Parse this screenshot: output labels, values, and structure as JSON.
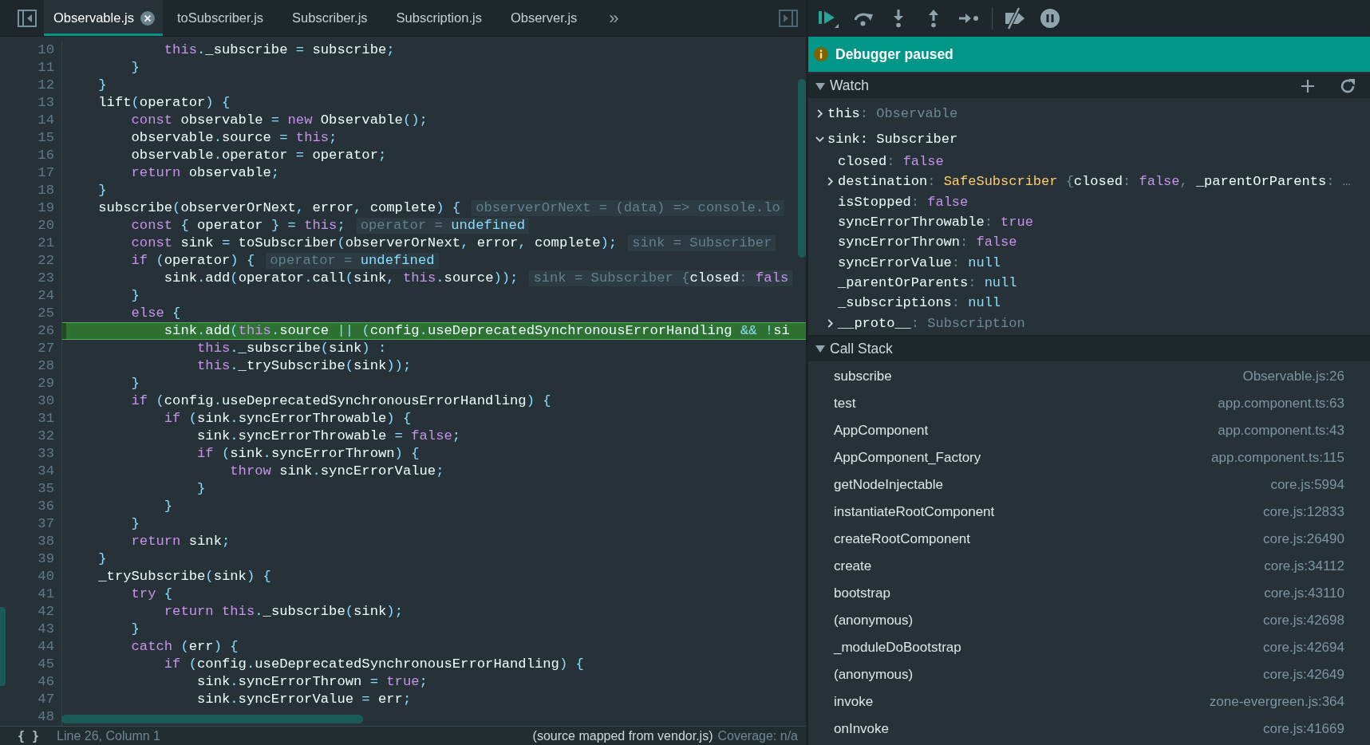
{
  "editor": {
    "tabs": [
      {
        "label": "Observable.js",
        "selected": true
      },
      {
        "label": "toSubscriber.js",
        "selected": false
      },
      {
        "label": "Subscriber.js",
        "selected": false
      },
      {
        "label": "Subscription.js",
        "selected": false
      },
      {
        "label": "Observer.js",
        "selected": false
      }
    ],
    "more_tabs": "»",
    "lines": [
      {
        "number": "10",
        "current": false,
        "tokens": [
          {
            "text": "            this",
            "kind": "keyword"
          },
          {
            "text": ".",
            "kind": "punct"
          },
          {
            "text": "_subscribe ",
            "kind": "plain"
          },
          {
            "text": "=",
            "kind": "punct"
          },
          {
            "text": " subscribe",
            "kind": "plain"
          },
          {
            "text": ";",
            "kind": "punct"
          }
        ]
      },
      {
        "number": "11",
        "current": false,
        "tokens": [
          {
            "text": "        }",
            "kind": "punct"
          }
        ]
      },
      {
        "number": "12",
        "current": false,
        "tokens": [
          {
            "text": "    }",
            "kind": "punct"
          }
        ]
      },
      {
        "number": "13",
        "current": false,
        "tokens": [
          {
            "text": "    lift",
            "kind": "plain"
          },
          {
            "text": "(",
            "kind": "punct"
          },
          {
            "text": "operator",
            "kind": "plain"
          },
          {
            "text": ") {",
            "kind": "punct"
          }
        ]
      },
      {
        "number": "14",
        "current": false,
        "tokens": [
          {
            "text": "        const",
            "kind": "keyword"
          },
          {
            "text": " observable ",
            "kind": "plain"
          },
          {
            "text": "=",
            "kind": "punct"
          },
          {
            "text": " new",
            "kind": "keyword"
          },
          {
            "text": " Observable",
            "kind": "plain"
          },
          {
            "text": "();",
            "kind": "punct"
          }
        ]
      },
      {
        "number": "15",
        "current": false,
        "tokens": [
          {
            "text": "        observable",
            "kind": "plain"
          },
          {
            "text": ".",
            "kind": "punct"
          },
          {
            "text": "source ",
            "kind": "plain"
          },
          {
            "text": "=",
            "kind": "punct"
          },
          {
            "text": " this",
            "kind": "keyword"
          },
          {
            "text": ";",
            "kind": "punct"
          }
        ]
      },
      {
        "number": "16",
        "current": false,
        "tokens": [
          {
            "text": "        observable",
            "kind": "plain"
          },
          {
            "text": ".",
            "kind": "punct"
          },
          {
            "text": "operator ",
            "kind": "plain"
          },
          {
            "text": "=",
            "kind": "punct"
          },
          {
            "text": " operator",
            "kind": "plain"
          },
          {
            "text": ";",
            "kind": "punct"
          }
        ]
      },
      {
        "number": "17",
        "current": false,
        "tokens": [
          {
            "text": "        return",
            "kind": "keyword"
          },
          {
            "text": " observable",
            "kind": "plain"
          },
          {
            "text": ";",
            "kind": "punct"
          }
        ]
      },
      {
        "number": "18",
        "current": false,
        "tokens": [
          {
            "text": "    }",
            "kind": "punct"
          }
        ]
      },
      {
        "number": "19",
        "current": false,
        "tokens": [
          {
            "text": "    subscribe",
            "kind": "plain"
          },
          {
            "text": "(",
            "kind": "punct"
          },
          {
            "text": "observerOrNext",
            "kind": "plain"
          },
          {
            "text": ",",
            "kind": "punct"
          },
          {
            "text": " error",
            "kind": "plain"
          },
          {
            "text": ",",
            "kind": "punct"
          },
          {
            "text": " complete",
            "kind": "plain"
          },
          {
            "text": ") {",
            "kind": "punct"
          }
        ],
        "inline_value": [
          {
            "text": "observerOrNext = (data) => console.lo",
            "kind": "hint"
          }
        ]
      },
      {
        "number": "20",
        "current": false,
        "tokens": [
          {
            "text": "        const",
            "kind": "keyword"
          },
          {
            "text": " {",
            "kind": "punct"
          },
          {
            "text": " operator ",
            "kind": "plain"
          },
          {
            "text": "} =",
            "kind": "punct"
          },
          {
            "text": " this",
            "kind": "keyword"
          },
          {
            "text": ";",
            "kind": "punct"
          }
        ],
        "inline_value": [
          {
            "text": "operator =",
            "kind": "hint"
          },
          {
            "text": " undefined",
            "kind": "literal"
          }
        ]
      },
      {
        "number": "21",
        "current": false,
        "tokens": [
          {
            "text": "        const",
            "kind": "keyword"
          },
          {
            "text": " sink ",
            "kind": "plain"
          },
          {
            "text": "=",
            "kind": "punct"
          },
          {
            "text": " toSubscriber",
            "kind": "plain"
          },
          {
            "text": "(",
            "kind": "punct"
          },
          {
            "text": "observerOrNext",
            "kind": "plain"
          },
          {
            "text": ",",
            "kind": "punct"
          },
          {
            "text": " error",
            "kind": "plain"
          },
          {
            "text": ",",
            "kind": "punct"
          },
          {
            "text": " complete",
            "kind": "plain"
          },
          {
            "text": ");",
            "kind": "punct"
          }
        ],
        "inline_value": [
          {
            "text": "sink = Subscriber",
            "kind": "hint"
          }
        ]
      },
      {
        "number": "22",
        "current": false,
        "tokens": [
          {
            "text": "        if",
            "kind": "keyword"
          },
          {
            "text": " (",
            "kind": "punct"
          },
          {
            "text": "operator",
            "kind": "plain"
          },
          {
            "text": ") {",
            "kind": "punct"
          }
        ],
        "inline_value": [
          {
            "text": "operator =",
            "kind": "hint"
          },
          {
            "text": " undefined",
            "kind": "literal"
          }
        ]
      },
      {
        "number": "23",
        "current": false,
        "tokens": [
          {
            "text": "            sink",
            "kind": "plain"
          },
          {
            "text": ".",
            "kind": "punct"
          },
          {
            "text": "add",
            "kind": "plain"
          },
          {
            "text": "(",
            "kind": "punct"
          },
          {
            "text": "operator",
            "kind": "plain"
          },
          {
            "text": ".",
            "kind": "punct"
          },
          {
            "text": "call",
            "kind": "plain"
          },
          {
            "text": "(",
            "kind": "punct"
          },
          {
            "text": "sink",
            "kind": "plain"
          },
          {
            "text": ",",
            "kind": "punct"
          },
          {
            "text": " this",
            "kind": "keyword"
          },
          {
            "text": ".",
            "kind": "punct"
          },
          {
            "text": "source",
            "kind": "plain"
          },
          {
            "text": "));",
            "kind": "punct"
          }
        ],
        "inline_value": [
          {
            "text": "sink = Subscriber {",
            "kind": "hint"
          },
          {
            "text": "closed",
            "kind": "plain"
          },
          {
            "text": ":",
            "kind": "hint"
          },
          {
            "text": " fals",
            "kind": "keyword"
          }
        ]
      },
      {
        "number": "24",
        "current": false,
        "tokens": [
          {
            "text": "        }",
            "kind": "punct"
          }
        ]
      },
      {
        "number": "25",
        "current": false,
        "tokens": [
          {
            "text": "        else",
            "kind": "keyword"
          },
          {
            "text": " {",
            "kind": "punct"
          }
        ]
      },
      {
        "number": "26",
        "current": true,
        "tokens": [
          {
            "text": "            sink",
            "kind": "plain"
          },
          {
            "text": ".",
            "kind": "punct"
          },
          {
            "text": "add",
            "kind": "plain"
          },
          {
            "text": "(",
            "kind": "punct"
          },
          {
            "text": "this",
            "kind": "keyword"
          },
          {
            "text": ".",
            "kind": "punct"
          },
          {
            "text": "source ",
            "kind": "plain"
          },
          {
            "text": "|| (",
            "kind": "punct"
          },
          {
            "text": "config",
            "kind": "plain"
          },
          {
            "text": ".",
            "kind": "punct"
          },
          {
            "text": "useDeprecatedSynchronousErrorHandling ",
            "kind": "plain"
          },
          {
            "text": "&& !",
            "kind": "punct"
          },
          {
            "text": "si",
            "kind": "plain"
          }
        ]
      },
      {
        "number": "27",
        "current": false,
        "tokens": [
          {
            "text": "                this",
            "kind": "keyword"
          },
          {
            "text": ".",
            "kind": "punct"
          },
          {
            "text": "_subscribe",
            "kind": "plain"
          },
          {
            "text": "(",
            "kind": "punct"
          },
          {
            "text": "sink",
            "kind": "plain"
          },
          {
            "text": ") :",
            "kind": "punct"
          }
        ]
      },
      {
        "number": "28",
        "current": false,
        "tokens": [
          {
            "text": "                this",
            "kind": "keyword"
          },
          {
            "text": ".",
            "kind": "punct"
          },
          {
            "text": "_trySubscribe",
            "kind": "plain"
          },
          {
            "text": "(",
            "kind": "punct"
          },
          {
            "text": "sink",
            "kind": "plain"
          },
          {
            "text": "));",
            "kind": "punct"
          }
        ]
      },
      {
        "number": "29",
        "current": false,
        "tokens": [
          {
            "text": "        }",
            "kind": "punct"
          }
        ]
      },
      {
        "number": "30",
        "current": false,
        "tokens": [
          {
            "text": "        if",
            "kind": "keyword"
          },
          {
            "text": " (",
            "kind": "punct"
          },
          {
            "text": "config",
            "kind": "plain"
          },
          {
            "text": ".",
            "kind": "punct"
          },
          {
            "text": "useDeprecatedSynchronousErrorHandling",
            "kind": "plain"
          },
          {
            "text": ") {",
            "kind": "punct"
          }
        ]
      },
      {
        "number": "31",
        "current": false,
        "tokens": [
          {
            "text": "            if",
            "kind": "keyword"
          },
          {
            "text": " (",
            "kind": "punct"
          },
          {
            "text": "sink",
            "kind": "plain"
          },
          {
            "text": ".",
            "kind": "punct"
          },
          {
            "text": "syncErrorThrowable",
            "kind": "plain"
          },
          {
            "text": ") {",
            "kind": "punct"
          }
        ]
      },
      {
        "number": "32",
        "current": false,
        "tokens": [
          {
            "text": "                sink",
            "kind": "plain"
          },
          {
            "text": ".",
            "kind": "punct"
          },
          {
            "text": "syncErrorThrowable ",
            "kind": "plain"
          },
          {
            "text": "=",
            "kind": "punct"
          },
          {
            "text": " false",
            "kind": "keyword"
          },
          {
            "text": ";",
            "kind": "punct"
          }
        ]
      },
      {
        "number": "33",
        "current": false,
        "tokens": [
          {
            "text": "                if",
            "kind": "keyword"
          },
          {
            "text": " (",
            "kind": "punct"
          },
          {
            "text": "sink",
            "kind": "plain"
          },
          {
            "text": ".",
            "kind": "punct"
          },
          {
            "text": "syncErrorThrown",
            "kind": "plain"
          },
          {
            "text": ") {",
            "kind": "punct"
          }
        ]
      },
      {
        "number": "34",
        "current": false,
        "tokens": [
          {
            "text": "                    throw",
            "kind": "keyword"
          },
          {
            "text": " sink",
            "kind": "plain"
          },
          {
            "text": ".",
            "kind": "punct"
          },
          {
            "text": "syncErrorValue",
            "kind": "plain"
          },
          {
            "text": ";",
            "kind": "punct"
          }
        ]
      },
      {
        "number": "35",
        "current": false,
        "tokens": [
          {
            "text": "                }",
            "kind": "punct"
          }
        ]
      },
      {
        "number": "36",
        "current": false,
        "tokens": [
          {
            "text": "            }",
            "kind": "punct"
          }
        ]
      },
      {
        "number": "37",
        "current": false,
        "tokens": [
          {
            "text": "        }",
            "kind": "punct"
          }
        ]
      },
      {
        "number": "38",
        "current": false,
        "tokens": [
          {
            "text": "        return",
            "kind": "keyword"
          },
          {
            "text": " sink",
            "kind": "plain"
          },
          {
            "text": ";",
            "kind": "punct"
          }
        ]
      },
      {
        "number": "39",
        "current": false,
        "tokens": [
          {
            "text": "    }",
            "kind": "punct"
          }
        ]
      },
      {
        "number": "40",
        "current": false,
        "tokens": [
          {
            "text": "    _trySubscribe",
            "kind": "plain"
          },
          {
            "text": "(",
            "kind": "punct"
          },
          {
            "text": "sink",
            "kind": "plain"
          },
          {
            "text": ") {",
            "kind": "punct"
          }
        ]
      },
      {
        "number": "41",
        "current": false,
        "tokens": [
          {
            "text": "        try",
            "kind": "keyword"
          },
          {
            "text": " {",
            "kind": "punct"
          }
        ]
      },
      {
        "number": "42",
        "current": false,
        "tokens": [
          {
            "text": "            return this",
            "kind": "keyword"
          },
          {
            "text": ".",
            "kind": "punct"
          },
          {
            "text": "_subscribe",
            "kind": "plain"
          },
          {
            "text": "(",
            "kind": "punct"
          },
          {
            "text": "sink",
            "kind": "plain"
          },
          {
            "text": ");",
            "kind": "punct"
          }
        ]
      },
      {
        "number": "43",
        "current": false,
        "tokens": [
          {
            "text": "        }",
            "kind": "punct"
          }
        ]
      },
      {
        "number": "44",
        "current": false,
        "tokens": [
          {
            "text": "        catch",
            "kind": "keyword"
          },
          {
            "text": " (",
            "kind": "punct"
          },
          {
            "text": "err",
            "kind": "plain"
          },
          {
            "text": ") {",
            "kind": "punct"
          }
        ]
      },
      {
        "number": "45",
        "current": false,
        "tokens": [
          {
            "text": "            if",
            "kind": "keyword"
          },
          {
            "text": " (",
            "kind": "punct"
          },
          {
            "text": "config",
            "kind": "plain"
          },
          {
            "text": ".",
            "kind": "punct"
          },
          {
            "text": "useDeprecatedSynchronousErrorHandling",
            "kind": "plain"
          },
          {
            "text": ") {",
            "kind": "punct"
          }
        ]
      },
      {
        "number": "46",
        "current": false,
        "tokens": [
          {
            "text": "                sink",
            "kind": "plain"
          },
          {
            "text": ".",
            "kind": "punct"
          },
          {
            "text": "syncErrorThrown ",
            "kind": "plain"
          },
          {
            "text": "=",
            "kind": "punct"
          },
          {
            "text": " true",
            "kind": "keyword"
          },
          {
            "text": ";",
            "kind": "punct"
          }
        ]
      },
      {
        "number": "47",
        "current": false,
        "tokens": [
          {
            "text": "                sink",
            "kind": "plain"
          },
          {
            "text": ".",
            "kind": "punct"
          },
          {
            "text": "syncErrorValue ",
            "kind": "plain"
          },
          {
            "text": "=",
            "kind": "punct"
          },
          {
            "text": " err",
            "kind": "plain"
          },
          {
            "text": ";",
            "kind": "punct"
          }
        ]
      },
      {
        "number": "48",
        "current": false
      }
    ],
    "status_bar": {
      "format_button": "{ }",
      "position": "Line 26, Column 1",
      "source_map": "(source mapped from vendor.js)",
      "coverage": "Coverage: n/a"
    }
  },
  "debugger": {
    "banner": "Debugger paused",
    "watch": {
      "title": "Watch",
      "expanded": true,
      "items": [
        {
          "kind": "object",
          "expanded": false,
          "tokens": [
            {
              "text": "this",
              "kind": "plain"
            },
            {
              "text": ": ",
              "kind": "punct"
            },
            {
              "text": "Observable",
              "kind": "description"
            }
          ]
        },
        {
          "kind": "object",
          "expanded": true,
          "tokens": [
            {
              "text": "sink: Subscriber",
              "kind": "plain"
            }
          ],
          "children": [
            {
              "kind": "leaf",
              "tokens": [
                {
                  "text": "closed",
                  "kind": "plain"
                },
                {
                  "text": ": ",
                  "kind": "punct"
                },
                {
                  "text": "false",
                  "kind": "keyword"
                }
              ]
            },
            {
              "kind": "object",
              "expanded": false,
              "tokens": [
                {
                  "text": "destination",
                  "kind": "plain"
                },
                {
                  "text": ": ",
                  "kind": "punct"
                },
                {
                  "text": "SafeSubscriber",
                  "kind": "class"
                },
                {
                  "text": " {",
                  "kind": "punct"
                },
                {
                  "text": "closed",
                  "kind": "plain"
                },
                {
                  "text": ": ",
                  "kind": "punct"
                },
                {
                  "text": "false",
                  "kind": "keyword"
                },
                {
                  "text": ", ",
                  "kind": "punct"
                },
                {
                  "text": "_parentOrParents",
                  "kind": "plain"
                },
                {
                  "text": ": …",
                  "kind": "punct"
                }
              ]
            },
            {
              "kind": "leaf",
              "tokens": [
                {
                  "text": "isStopped",
                  "kind": "plain"
                },
                {
                  "text": ": ",
                  "kind": "punct"
                },
                {
                  "text": "false",
                  "kind": "keyword"
                }
              ]
            },
            {
              "kind": "leaf",
              "tokens": [
                {
                  "text": "syncErrorThrowable",
                  "kind": "plain"
                },
                {
                  "text": ": ",
                  "kind": "punct"
                },
                {
                  "text": "true",
                  "kind": "keyword"
                }
              ]
            },
            {
              "kind": "leaf",
              "tokens": [
                {
                  "text": "syncErrorThrown",
                  "kind": "plain"
                },
                {
                  "text": ": ",
                  "kind": "punct"
                },
                {
                  "text": "false",
                  "kind": "keyword"
                }
              ]
            },
            {
              "kind": "leaf",
              "tokens": [
                {
                  "text": "syncErrorValue",
                  "kind": "plain"
                },
                {
                  "text": ": ",
                  "kind": "punct"
                },
                {
                  "text": "null",
                  "kind": "literal"
                }
              ]
            },
            {
              "kind": "leaf",
              "tokens": [
                {
                  "text": "_parentOrParents",
                  "kind": "plain"
                },
                {
                  "text": ": ",
                  "kind": "punct"
                },
                {
                  "text": "null",
                  "kind": "literal"
                }
              ]
            },
            {
              "kind": "leaf",
              "tokens": [
                {
                  "text": "_subscriptions",
                  "kind": "plain"
                },
                {
                  "text": ": ",
                  "kind": "punct"
                },
                {
                  "text": "null",
                  "kind": "literal"
                }
              ]
            },
            {
              "kind": "object",
              "expanded": false,
              "tokens": [
                {
                  "text": "__proto__",
                  "kind": "plain"
                },
                {
                  "text": ": ",
                  "kind": "punct"
                },
                {
                  "text": "Subscription",
                  "kind": "description"
                }
              ]
            }
          ]
        }
      ]
    },
    "call_stack": {
      "title": "Call Stack",
      "expanded": true,
      "frames": [
        {
          "function": "subscribe",
          "location": "Observable.js:26"
        },
        {
          "function": "test",
          "location": "app.component.ts:63"
        },
        {
          "function": "AppComponent",
          "location": "app.component.ts:43"
        },
        {
          "function": "AppComponent_Factory",
          "location": "app.component.ts:115"
        },
        {
          "function": "getNodeInjectable",
          "location": "core.js:5994"
        },
        {
          "function": "instantiateRootComponent",
          "location": "core.js:12833"
        },
        {
          "function": "createRootComponent",
          "location": "core.js:26490"
        },
        {
          "function": "create",
          "location": "core.js:34112"
        },
        {
          "function": "bootstrap",
          "location": "core.js:43110"
        },
        {
          "function": "(anonymous)",
          "location": "core.js:42698"
        },
        {
          "function": "_moduleDoBootstrap",
          "location": "core.js:42694"
        },
        {
          "function": "(anonymous)",
          "location": "core.js:42649"
        },
        {
          "function": "invoke",
          "location": "zone-evergreen.js:364"
        },
        {
          "function": "onInvoke",
          "location": "core.js:41669"
        }
      ]
    }
  }
}
